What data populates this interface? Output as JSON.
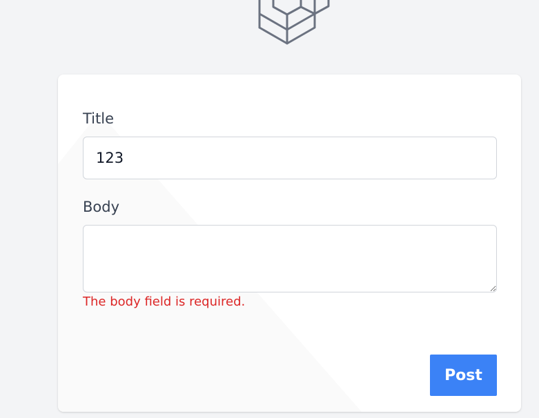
{
  "form": {
    "title_label": "Title",
    "title_value": "123",
    "body_label": "Body",
    "body_value": "",
    "body_error": "The body field is required.",
    "submit_label": "Post"
  },
  "icons": {
    "logo": "laravel-cube-logo-icon",
    "resize": "resize-handle-icon"
  },
  "colors": {
    "background": "#f3f4f6",
    "card": "#ffffff",
    "label_text": "#374151",
    "error": "#dc2626",
    "primary_button": "#3b82f6",
    "logo_stroke": "#6b7280"
  }
}
